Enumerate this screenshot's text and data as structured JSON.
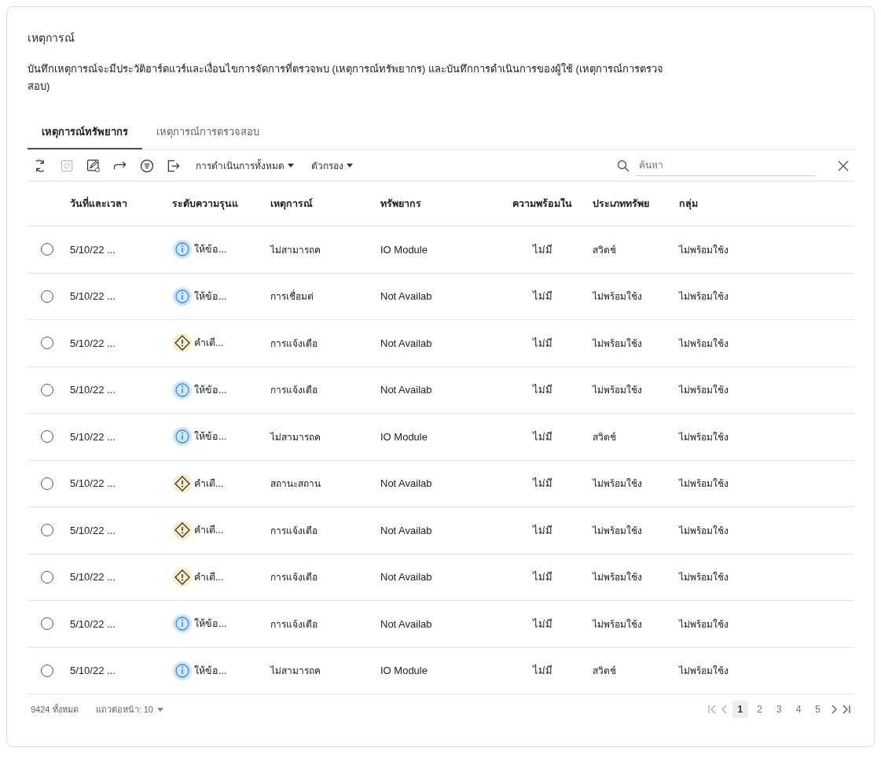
{
  "title": "เหตุการณ์",
  "description": "บันทึกเหตุการณ์จะมีประวัติฮาร์ดแวร์และเงื่อนไขการจัดการที่ตรวจพบ (เหตุการณ์ทรัพยากร) และบันทึกการดำเนินการของผู้ใช้ (เหตุการณ์การตรวจสอบ)",
  "tabs": [
    {
      "label": "เหตุการณ์ทรัพยากร",
      "selected": true
    },
    {
      "label": "เหตุการณ์การตรวจสอบ",
      "selected": false
    }
  ],
  "toolbar": {
    "icons": [
      {
        "kind": "refresh",
        "disabled": false
      },
      {
        "kind": "exclude",
        "disabled": true
      },
      {
        "kind": "edit",
        "disabled": false
      },
      {
        "kind": "forward",
        "disabled": false
      },
      {
        "kind": "filter",
        "disabled": false
      },
      {
        "kind": "export",
        "disabled": false
      }
    ],
    "menus": [
      "การดำเนินการทั้งหมด",
      "ตัวกรอง"
    ],
    "search": {
      "placeholder": "ค้นหา"
    }
  },
  "table": {
    "columns": [
      "วันที่และเวลา",
      "ระดับความรุนแ",
      "เหตุการณ์",
      "ทรัพยากร",
      "ความพร้อมใน",
      "ประเภททรัพย",
      "กลุ่ม"
    ],
    "rows": [
      {
        "selected": false,
        "date": "5/10/22 ...",
        "severity": {
          "kind": "info",
          "label": "ให้ข้อ..."
        },
        "event": "ไม่สามารถค",
        "resource": "IO Module",
        "availability": "ไม่มี",
        "type": "สวิตช์",
        "group": "ไม่พร้อมใช้ง"
      },
      {
        "selected": false,
        "date": "5/10/22 ...",
        "severity": {
          "kind": "info",
          "label": "ให้ข้อ..."
        },
        "event": "การเชื่อมต่",
        "resource": "Not Availab",
        "availability": "ไม่มี",
        "type": "ไม่พร้อมใช้ง",
        "group": "ไม่พร้อมใช้ง"
      },
      {
        "selected": false,
        "date": "5/10/22 ...",
        "severity": {
          "kind": "warning",
          "label": "คำเตื..."
        },
        "event": "การแจ้งเตือ",
        "resource": "Not Availab",
        "availability": "ไม่มี",
        "type": "ไม่พร้อมใช้ง",
        "group": "ไม่พร้อมใช้ง"
      },
      {
        "selected": false,
        "date": "5/10/22 ...",
        "severity": {
          "kind": "info",
          "label": "ให้ข้อ..."
        },
        "event": "การแจ้งเตือ",
        "resource": "Not Availab",
        "availability": "ไม่มี",
        "type": "ไม่พร้อมใช้ง",
        "group": "ไม่พร้อมใช้ง"
      },
      {
        "selected": false,
        "date": "5/10/22 ...",
        "severity": {
          "kind": "info",
          "label": "ให้ข้อ..."
        },
        "event": "ไม่สามารถค",
        "resource": "IO Module",
        "availability": "ไม่มี",
        "type": "สวิตช์",
        "group": "ไม่พร้อมใช้ง"
      },
      {
        "selected": false,
        "date": "5/10/22 ...",
        "severity": {
          "kind": "warning",
          "label": "คำเตื..."
        },
        "event": "สถานะสถาน",
        "resource": "Not Availab",
        "availability": "ไม่มี",
        "type": "ไม่พร้อมใช้ง",
        "group": "ไม่พร้อมใช้ง"
      },
      {
        "selected": false,
        "date": "5/10/22 ...",
        "severity": {
          "kind": "warning",
          "label": "คำเตื..."
        },
        "event": "การแจ้งเตือ",
        "resource": "Not Availab",
        "availability": "ไม่มี",
        "type": "ไม่พร้อมใช้ง",
        "group": "ไม่พร้อมใช้ง"
      },
      {
        "selected": false,
        "date": "5/10/22 ...",
        "severity": {
          "kind": "warning",
          "label": "คำเตื..."
        },
        "event": "การแจ้งเตือ",
        "resource": "Not Availab",
        "availability": "ไม่มี",
        "type": "ไม่พร้อมใช้ง",
        "group": "ไม่พร้อมใช้ง"
      },
      {
        "selected": false,
        "date": "5/10/22 ...",
        "severity": {
          "kind": "info",
          "label": "ให้ข้อ..."
        },
        "event": "การแจ้งเตือ",
        "resource": "Not Availab",
        "availability": "ไม่มี",
        "type": "ไม่พร้อมใช้ง",
        "group": "ไม่พร้อมใช้ง"
      },
      {
        "selected": false,
        "date": "5/10/22 ...",
        "severity": {
          "kind": "info",
          "label": "ให้ข้อ..."
        },
        "event": "ไม่สามารถค",
        "resource": "IO Module",
        "availability": "ไม่มี",
        "type": "สวิตช์",
        "group": "ไม่พร้อมใช้ง"
      }
    ]
  },
  "footer": {
    "total": "9424 ทั้งหมด",
    "per_page": "แถวต่อหน้า: 10",
    "pages": [
      {
        "label": "1",
        "selected": true
      },
      {
        "label": "2",
        "selected": false
      },
      {
        "label": "3",
        "selected": false
      },
      {
        "label": "4",
        "selected": false
      },
      {
        "label": "5",
        "selected": false
      }
    ]
  }
}
